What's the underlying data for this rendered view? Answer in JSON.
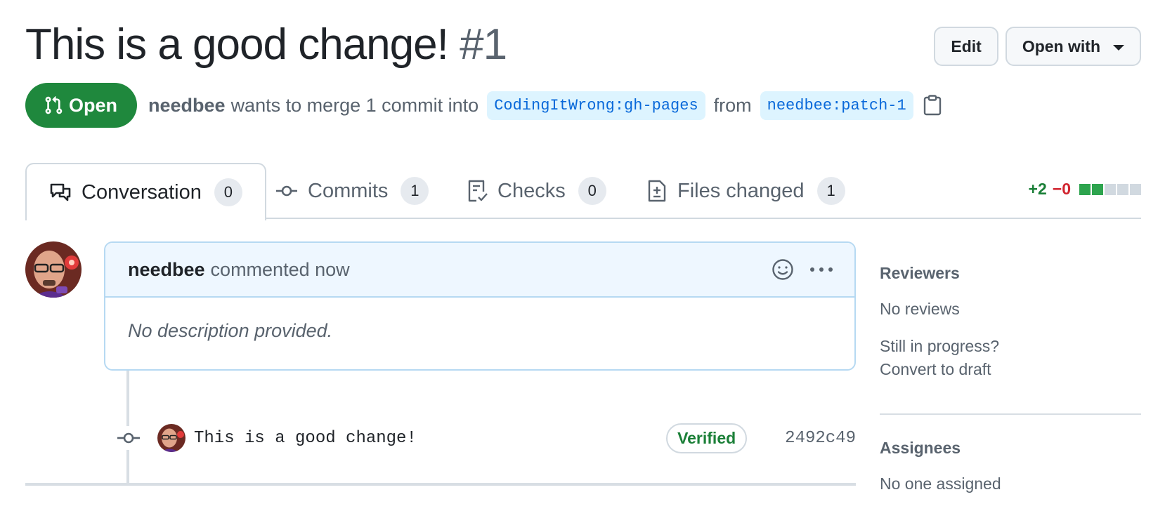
{
  "pr": {
    "title": "This is a good change!",
    "number": "#1",
    "state": "Open",
    "author": "needbee",
    "merge_text_1": "wants to merge 1 commit into",
    "base_branch": "CodingItWrong:gh-pages",
    "merge_text_2": "from",
    "head_branch": "needbee:patch-1"
  },
  "header_actions": {
    "edit_label": "Edit",
    "open_with_label": "Open with"
  },
  "tabs": [
    {
      "label": "Conversation",
      "count": "0",
      "icon": "comment-discussion-icon"
    },
    {
      "label": "Commits",
      "count": "1",
      "icon": "git-commit-icon"
    },
    {
      "label": "Checks",
      "count": "0",
      "icon": "checklist-icon"
    },
    {
      "label": "Files changed",
      "count": "1",
      "icon": "file-diff-icon"
    }
  ],
  "diffstat": {
    "additions": "+2",
    "deletions": "−0",
    "blocks": [
      "added",
      "added",
      "neutral",
      "neutral",
      "neutral"
    ],
    "colors": {
      "added": "#2da44e",
      "neutral": "#d1d9e0"
    }
  },
  "comment": {
    "author": "needbee",
    "action": "commented now",
    "body": "No description provided."
  },
  "commit": {
    "message": "This is a good change!",
    "badge": "Verified",
    "sha": "2492c49"
  },
  "sidebar": {
    "reviewers_heading": "Reviewers",
    "reviewers_value": "No reviews",
    "draft_line1": "Still in progress?",
    "draft_line2": "Convert to draft",
    "assignees_heading": "Assignees",
    "assignees_value": "No one assigned"
  },
  "colors": {
    "open_green": "#1f883d",
    "link_blue": "#0969da",
    "branch_bg": "#ddf4ff",
    "verified_green": "#1a7f37",
    "deletion_red": "#d1242f"
  }
}
